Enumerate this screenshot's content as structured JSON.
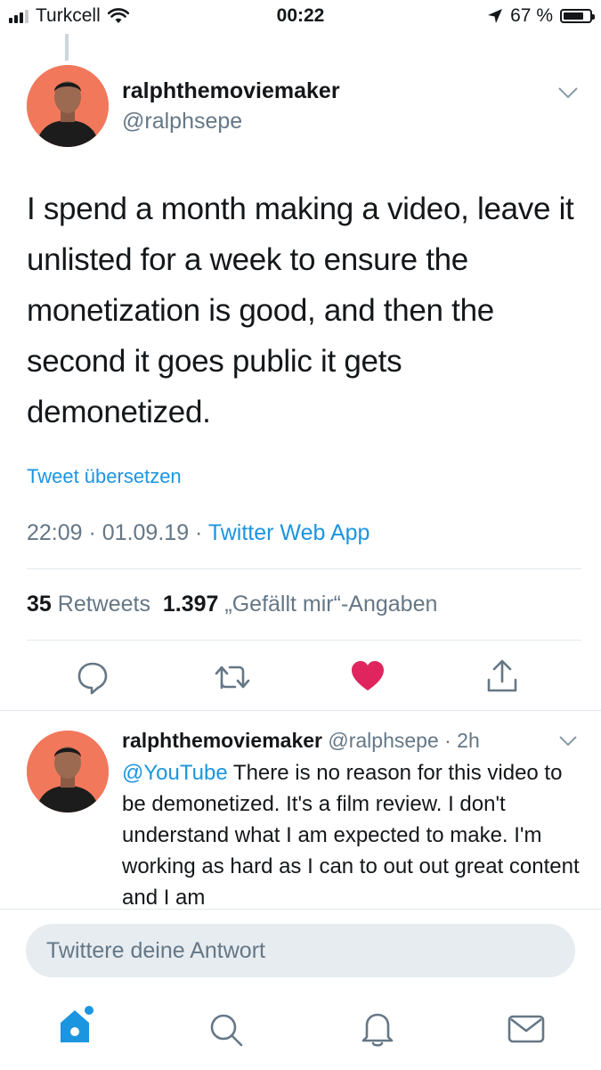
{
  "status_bar": {
    "carrier": "Turkcell",
    "time": "00:22",
    "battery": "67 %"
  },
  "tweet": {
    "display_name": "ralphthemoviemaker",
    "handle": "@ralphsepe",
    "text": "I spend a month making a video, leave it unlisted for a week to ensure the monetization is good, and then the second it goes public it gets demonetized.",
    "translate_link": "Tweet übersetzen",
    "timestamp": "22:09 · 01.09.19 · ",
    "source": "Twitter Web App",
    "retweets_count": "35",
    "retweets_label": "Retweets",
    "likes_count": "1.397",
    "likes_label": "„Gefällt mir“-Angaben"
  },
  "actions": {
    "icons": [
      "reply-icon",
      "retweet-icon",
      "like-icon",
      "share-icon"
    ],
    "like_color": "#e0245e",
    "accent_color": "#1b95e0"
  },
  "reply": {
    "display_name": "ralphthemoviemaker",
    "handle_time": "@ralphsepe · 2h",
    "mention": "@YouTube",
    "text": " There is no reason for this video to be demonetized. It's a film review. I don't understand what I am expected to make. I'm working as hard as I can to out out great content and I am"
  },
  "compose": {
    "placeholder": "Twittere deine Antwort"
  },
  "tab_bar": {
    "icons": [
      "home-icon",
      "search-icon",
      "notifications-icon",
      "messages-icon"
    ]
  }
}
